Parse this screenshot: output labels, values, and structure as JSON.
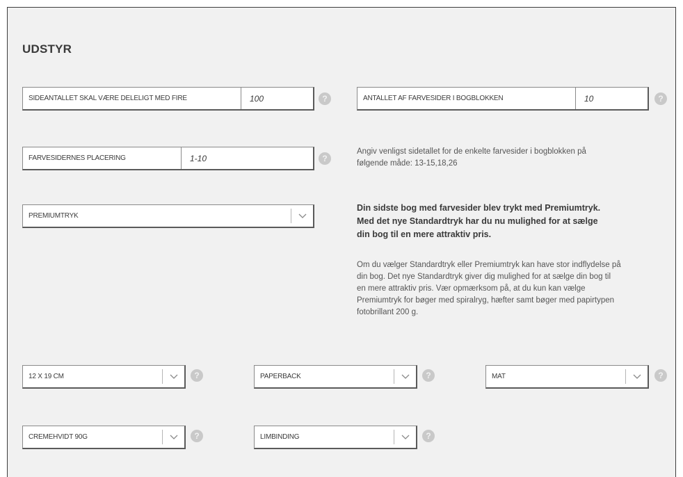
{
  "section": {
    "title": "UDSTYR"
  },
  "page_count": {
    "label": "SIDEANTALLET SKAL VÆRE DELELIGT MED FIRE",
    "value": "100"
  },
  "color_pages": {
    "label": "ANTALLET AF FARVESIDER I BOGBLOKKEN",
    "value": "10"
  },
  "color_placement": {
    "label": "FARVESIDERNES PLACERING",
    "value": "1-10",
    "hint": "Angiv venligst sidetallet for de enkelte farvesider i bogblokken på følgende måde: 13-15,18,26"
  },
  "print_type": {
    "selected": "PREMIUMTRYK",
    "notice": "Din sidste bog med farvesider blev trykt med Premiumtryk. Med det nye Standardtryk har du nu mulighed for at sælge din bog til en mere attraktiv pris.",
    "description": "Om du vælger Standardtryk eller Premiumtryk kan have stor indflydelse på din bog. Det nye Standardtryk giver dig mulighed for at sælge din bog til en mere attraktiv pris. Vær opmærksom på, at du kun kan vælge Premiumtryk for bøger med spiralryg, hæfter samt bøger med papirtypen fotobrillant 200 g."
  },
  "format": {
    "selected": "12 X 19 CM"
  },
  "cover_type": {
    "selected": "PAPERBACK"
  },
  "finish": {
    "selected": "MAT"
  },
  "paper": {
    "selected": "CREMEHVIDT 90G"
  },
  "binding": {
    "selected": "LIMBINDING"
  },
  "help_glyph": "?",
  "icons": {
    "help": "question-circle-icon",
    "dropdown": "chevron-down-icon"
  },
  "colors": {
    "panel_bg": "#f1f1f1",
    "help_icon": "#c9c9c9",
    "text": "#3a3a3a"
  }
}
